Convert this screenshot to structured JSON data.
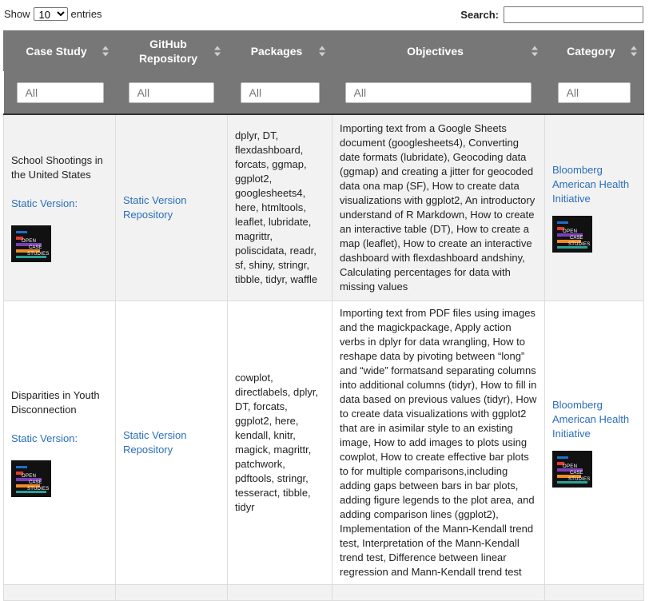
{
  "controls": {
    "show_label": "Show",
    "entries_value": "10",
    "entries_label": "entries",
    "search_label": "Search:",
    "search_value": ""
  },
  "columns": [
    {
      "label": "Case Study",
      "filter_placeholder": "All"
    },
    {
      "label": "GitHub Repository",
      "filter_placeholder": "All"
    },
    {
      "label": "Packages",
      "filter_placeholder": "All"
    },
    {
      "label": "Objectives",
      "filter_placeholder": "All"
    },
    {
      "label": "Category",
      "filter_placeholder": "All"
    }
  ],
  "rows": [
    {
      "case_study": "School Shootings in the United States",
      "static_link": "Static Version:",
      "repo_link_1": "Static Version",
      "repo_link_2": "Repository",
      "packages": "dplyr, DT, flexdashboard, forcats, ggmap, ggplot2, googlesheets4, here, htmltools, leaflet, lubridate, magrittr, poliscidata, readr, sf, shiny, stringr, tibble, tidyr, waffle",
      "objectives": "Importing text from a Google Sheets document (googlesheets4), Converting date formats (lubridate), Geocoding data (ggmap) and creating a jitter for geocoded data ona map (SF), How to create data visualizations with ggplot2, An introductory understand of R Markdown, How to create an interactive table (DT), How to create a map (leaflet), How to create an interactive dashboard with flexdashboard andshiny, Calculating percentages for data with missing values",
      "category": "Bloomberg American Health Initiative"
    },
    {
      "case_study": "Disparities in Youth Disconnection",
      "static_link": "Static Version:",
      "repo_link_1": "Static Version",
      "repo_link_2": "Repository",
      "packages": "cowplot, directlabels, dplyr, DT, forcats, ggplot2, here, kendall, knitr, magick, magrittr, patchwork, pdftools, stringr, tesseract, tibble, tidyr",
      "objectives": "Importing text from PDF files using images and the magickpackage, Apply action verbs in dplyr for data wrangling, How to reshape data by pivoting between “long” and “wide” formatsand separating columns into additional columns (tidyr), How to fill in data based on previous values (tidyr), How to create data visualizations with ggplot2 that are in asimilar style to an existing image, How to add images to plots using cowplot, How to create effective bar plots to for multiple comparisons,including adding gaps between bars in bar plots, adding figure legends to the plot area, and adding comparison lines (ggplot2), Implementation of the Mann-Kendall trend test, Interpretation of the Mann-Kendall trend test, Difference between linear regression and Mann-Kendall trend test",
      "category": "Bloomberg American Health Initiative"
    }
  ],
  "logo": {
    "line1": "OPEN",
    "line2": "CASE",
    "line3": "STUDIES",
    "colors": [
      "#1e6fc9",
      "#e03c31",
      "#7a3fb6",
      "#f08a24",
      "#2aa198"
    ]
  }
}
